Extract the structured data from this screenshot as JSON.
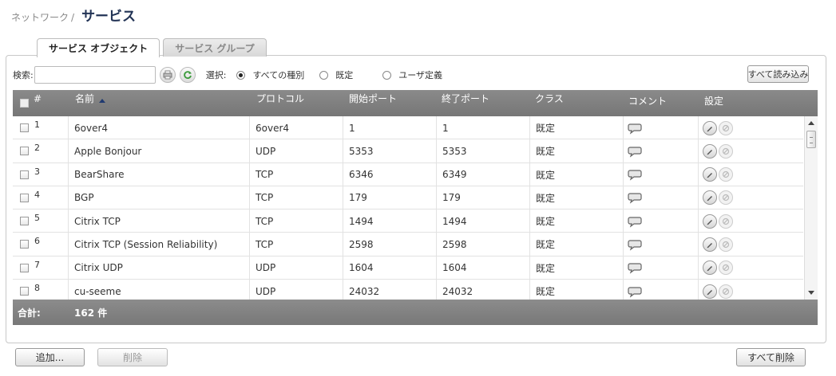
{
  "breadcrumb": {
    "parent": "ネットワーク",
    "separator": "/",
    "title": "サービス"
  },
  "tabs": [
    {
      "label": "サービス オブジェクト",
      "active": true
    },
    {
      "label": "サービス グループ",
      "active": false
    }
  ],
  "toolbar": {
    "search_label": "検索:",
    "search_value": "",
    "select_label": "選択:",
    "radios": [
      {
        "label": "すべての種別",
        "checked": true
      },
      {
        "label": "既定",
        "checked": false
      },
      {
        "label": "ユーザ定義",
        "checked": false
      }
    ],
    "reload_label": "すべて読み込み"
  },
  "table": {
    "columns": [
      "#",
      "名前",
      "プロトコル",
      "開始ポート",
      "終了ポート",
      "クラス",
      "コメント",
      "設定"
    ],
    "sort_column": "名前",
    "sort_direction": "ascending",
    "rows": [
      {
        "num": "1",
        "name": "6over4",
        "protocol": "6over4",
        "start": "1",
        "end": "1",
        "class": "既定"
      },
      {
        "num": "2",
        "name": "Apple Bonjour",
        "protocol": "UDP",
        "start": "5353",
        "end": "5353",
        "class": "既定"
      },
      {
        "num": "3",
        "name": "BearShare",
        "protocol": "TCP",
        "start": "6346",
        "end": "6349",
        "class": "既定"
      },
      {
        "num": "4",
        "name": "BGP",
        "protocol": "TCP",
        "start": "179",
        "end": "179",
        "class": "既定"
      },
      {
        "num": "5",
        "name": "Citrix TCP",
        "protocol": "TCP",
        "start": "1494",
        "end": "1494",
        "class": "既定"
      },
      {
        "num": "6",
        "name": "Citrix TCP (Session Reliability)",
        "protocol": "TCP",
        "start": "2598",
        "end": "2598",
        "class": "既定"
      },
      {
        "num": "7",
        "name": "Citrix UDP",
        "protocol": "UDP",
        "start": "1604",
        "end": "1604",
        "class": "既定"
      },
      {
        "num": "8",
        "name": "cu-seeme",
        "protocol": "UDP",
        "start": "24032",
        "end": "24032",
        "class": "既定"
      }
    ],
    "footer": {
      "total_label": "合計:",
      "total_value": "162 件"
    }
  },
  "buttons": {
    "add": "追加...",
    "delete": "削除",
    "delete_all": "すべて削除"
  },
  "colors": {
    "header_bg": "#7f7f7f",
    "title": "#223355",
    "sort_arrow": "#203a70"
  }
}
